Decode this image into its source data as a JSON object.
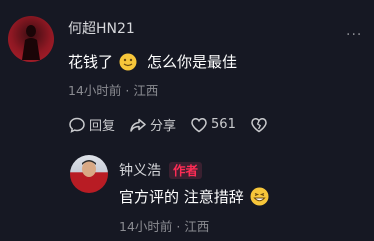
{
  "comment1": {
    "username": "何超HN21",
    "text_before": "花钱了",
    "text_after": "怎么你是最佳",
    "time": "14小时前",
    "location": "江西",
    "reply_label": "回复",
    "share_label": "分享",
    "like_count": "561"
  },
  "comment2": {
    "username": "钟义浩",
    "author_tag": "作者",
    "text_main": "官方评的 注意措辞",
    "time": "14小时前",
    "location": "江西"
  },
  "more_label": "···",
  "colors": {
    "background": "#161823",
    "accent": "#fe2c55",
    "muted": "#8a8b91"
  }
}
